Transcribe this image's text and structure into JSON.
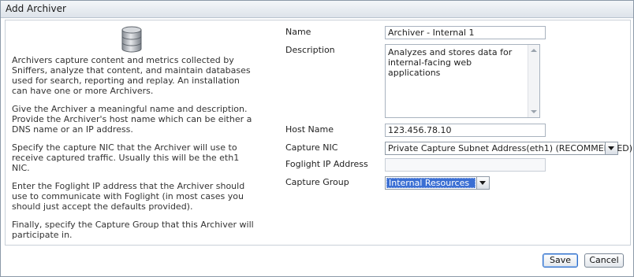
{
  "window": {
    "title": "Add Archiver"
  },
  "help": {
    "paragraphs": [
      "Archivers capture content and metrics collected by Sniffers, analyze that content, and maintain databases used for search, reporting and replay. An installation can have one or more Archivers.",
      "Give the Archiver a meaningful name and description. Provide the Archiver's host name which can be either a DNS name or an IP address.",
      "Specify the capture NIC that the Archiver will use to receive captured traffic. Usually this will be the eth1 NIC.",
      "Enter the Foglight IP address that the Archiver should use to communicate with Foglight (in most cases you should just accept the defaults provided).",
      "Finally, specify the Capture Group that this Archiver will participate in."
    ]
  },
  "form": {
    "name_label": "Name",
    "name_value": "Archiver - Internal 1",
    "description_label": "Description",
    "description_value": "Analyzes and stores data for internal-facing web applications",
    "host_label": "Host Name",
    "host_value": "123.456.78.10",
    "nic_label": "Capture NIC",
    "nic_value": "Private Capture Subnet Address(eth1) (RECOMMENDED)",
    "foglight_label": "Foglight IP Address",
    "foglight_value": "",
    "group_label": "Capture Group",
    "group_value": "Internal Resources"
  },
  "buttons": {
    "save": "Save",
    "cancel": "Cancel"
  },
  "icons": {
    "database": "database-icon",
    "dropdown": "chevron-down-icon"
  },
  "colors": {
    "selection": "#3b6fd3",
    "default_button_border": "#2b6bc7"
  }
}
